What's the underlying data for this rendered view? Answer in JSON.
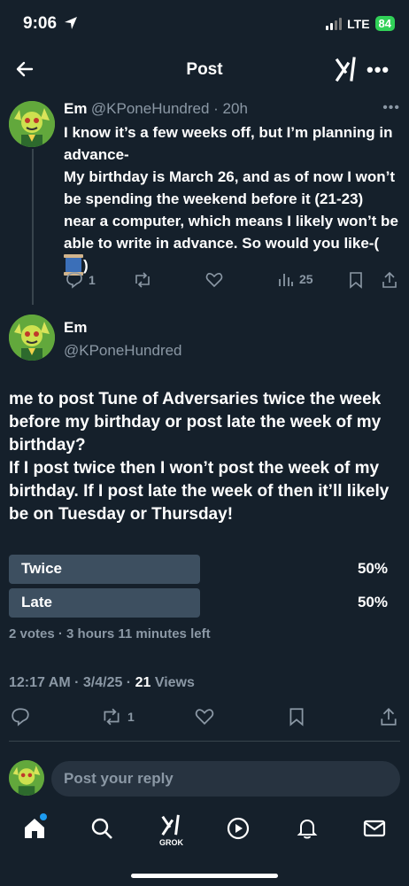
{
  "status_bar": {
    "time": "9:06",
    "network": "LTE",
    "battery": "84"
  },
  "header": {
    "title": "Post"
  },
  "parent_tweet": {
    "name": "Em",
    "handle_time": "@KPoneHundred · 20h",
    "text": "I know it’s a few weeks off, but I’m planning in advance-\nMy birthday is March 26, and as of now I won’t be spending the weekend before it (21-23) near a computer, which means I likely won’t be able to write in advance. So would you like-(",
    "text_end": ")",
    "emoji_icon": "spool-of-thread-emoji",
    "replies": "1",
    "views": "25"
  },
  "main_tweet": {
    "name": "Em",
    "handle": "@KPoneHundred",
    "text": "me to post Tune of Adversaries twice the week before my birthday or post late the week of my birthday?\nIf I post twice then I won’t post the week of my birthday. If I post late the week of then it’ll likely be on Tuesday or Thursday!",
    "poll": {
      "options": [
        {
          "label": "Twice",
          "percent": "50%",
          "fill": 0.5
        },
        {
          "label": "Late",
          "percent": "50%",
          "fill": 0.5
        }
      ],
      "meta": "2 votes · 3 hours 11 minutes left"
    },
    "timestamp": "12:17 AM · 3/4/25 · ",
    "views_count": "21",
    "views_label": " Views",
    "reposts": "1"
  },
  "reply_bar": {
    "placeholder": "Post your reply"
  },
  "tab_bar": {
    "grok_label": "GROK"
  },
  "colors": {
    "background": "#15202b",
    "muted": "#8b98a5",
    "accent": "#1d9bf0",
    "poll_bar": "#3d4f60"
  }
}
